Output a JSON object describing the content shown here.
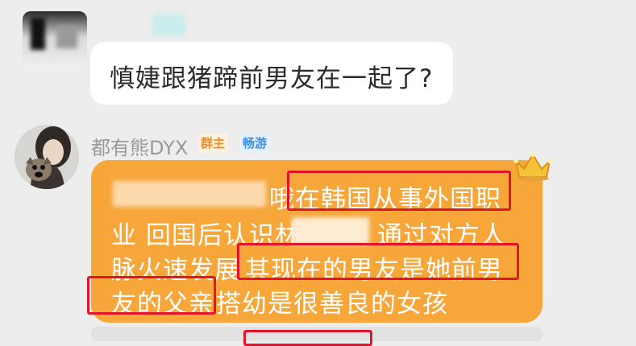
{
  "messages": [
    {
      "avatar_icon": "blurred-avatar-icon",
      "text": "慎婕跟猪蹄前男友在一起了?"
    },
    {
      "avatar_icon": "girl-with-dog-avatar-icon",
      "sender": "都有熊DYX",
      "badges": {
        "owner": "群主",
        "tour": "畅游"
      },
      "lines": [
        {
          "visible_end": "哦",
          "highlight": "在韩国从事外国职"
        },
        {
          "start": "业 回国后认识林",
          "end": "通过对方人"
        },
        {
          "start": "脉火速发展",
          "highlight": "其现在的男友是她前男"
        },
        {
          "highlight": "友的父亲",
          "end": "搭幼是很善良的女孩"
        }
      ],
      "crown_icon": "crown-icon"
    }
  ],
  "colors": {
    "background": "#ededed",
    "bubble_orange": "#f7a63a",
    "highlight_border": "#e3152b"
  }
}
